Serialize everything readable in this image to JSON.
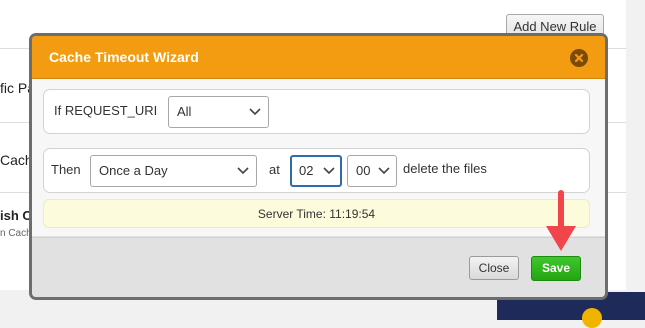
{
  "background": {
    "add_rule_label": "Add New Rule",
    "partial_1": "fic Pa",
    "partial_2": "Cach",
    "partial_3": "ish Ca",
    "partial_3_sub": "n Cache"
  },
  "dialog": {
    "title": "Cache Timeout Wizard",
    "if_label": "If REQUEST_URI",
    "uri_select_value": "All",
    "then_label": "Then",
    "frequency_value": "Once a Day",
    "at_label": "at",
    "hour_value": "02",
    "minute_value": "00",
    "suffix_label": "delete the files",
    "server_time": "Server Time: 11:19:54",
    "close_label": "Close",
    "save_label": "Save"
  },
  "colors": {
    "header": "#f39c12",
    "save": "#2fb51c",
    "focus": "#2f6cab",
    "arrow": "#f0454a"
  },
  "icons": {
    "close": "close-circle-icon",
    "chevron": "chevron-down-icon",
    "annotation": "red-arrow-icon"
  }
}
